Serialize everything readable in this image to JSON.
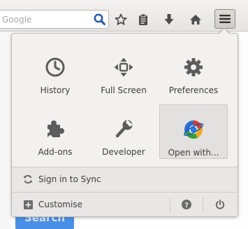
{
  "toolbar": {
    "search": {
      "placeholder": "Google",
      "value": "",
      "go_icon": "search-icon"
    },
    "buttons": [
      {
        "name": "bookmark-star",
        "icon": "star-icon"
      },
      {
        "name": "reading-list",
        "icon": "clipboard-icon"
      },
      {
        "name": "downloads",
        "icon": "download-arrow-icon"
      },
      {
        "name": "home",
        "icon": "home-icon"
      }
    ],
    "menu_icon": "hamburger-icon"
  },
  "panel": {
    "items": [
      {
        "label": "History",
        "icon": "clock-icon"
      },
      {
        "label": "Full Screen",
        "icon": "fullscreen-arrows-icon"
      },
      {
        "label": "Preferences",
        "icon": "gear-icon"
      },
      {
        "label": "Add-ons",
        "icon": "puzzle-piece-icon"
      },
      {
        "label": "Developer",
        "icon": "wrench-icon"
      },
      {
        "label": "Open with...",
        "icon": "web-browser-icon",
        "selected": true
      }
    ],
    "sync": {
      "label": "Sign in to Sync",
      "icon": "sync-icon"
    },
    "customise": {
      "label": "Customise",
      "icon": "plus-box-icon"
    },
    "help_icon": "help-icon",
    "quit_icon": "power-icon"
  },
  "background_page": {
    "button_label": "Search"
  },
  "colors": {
    "toolbar_bg": "#e6e4e1",
    "panel_bg": "#f2f1f0",
    "icon_gray": "#5c5c5c",
    "accent_blue": "#4a8fe6"
  }
}
